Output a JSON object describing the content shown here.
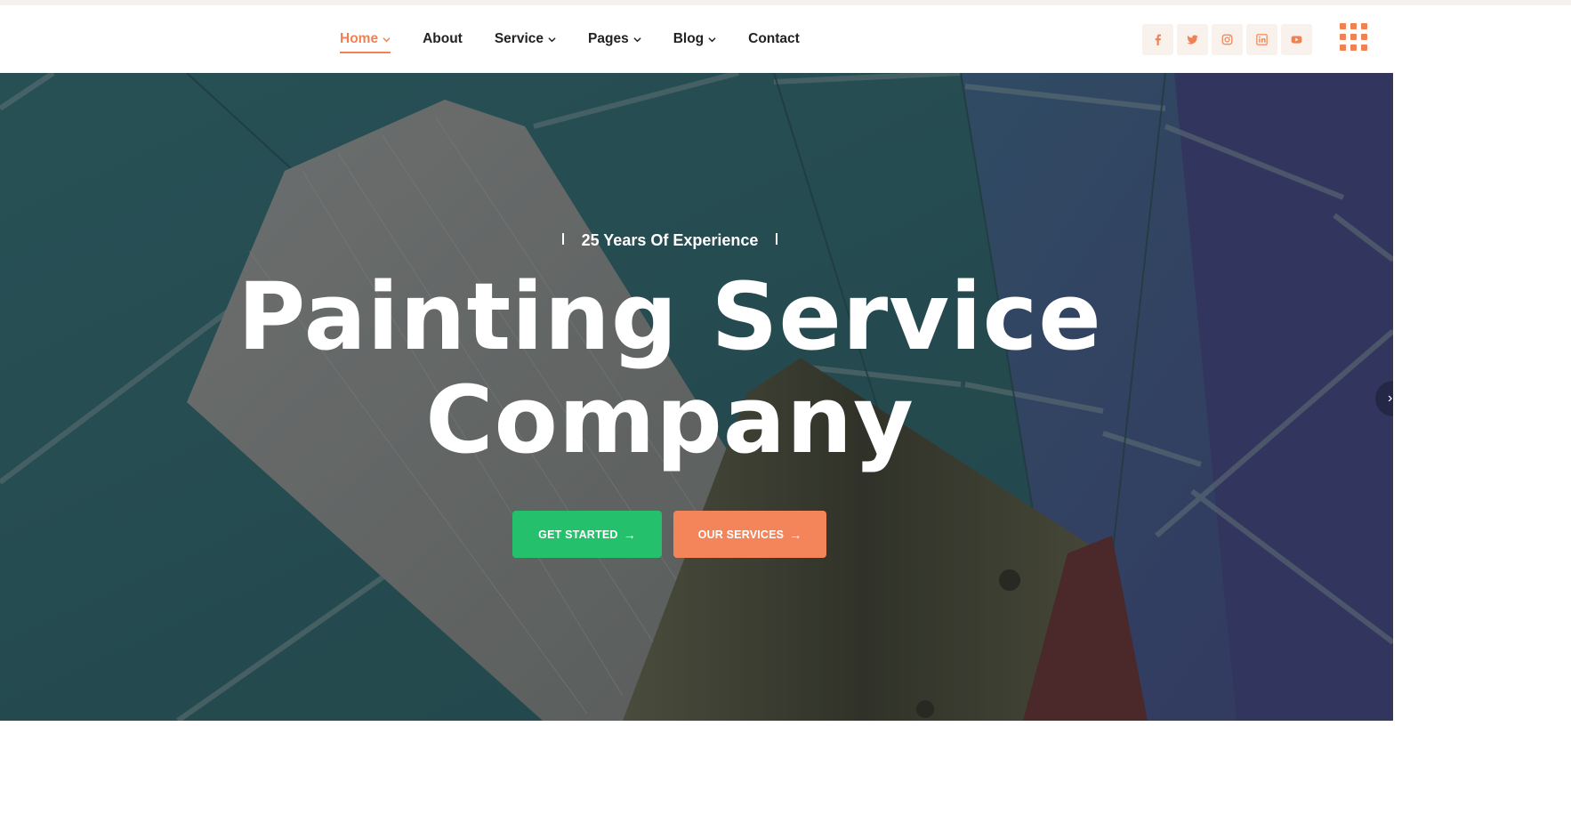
{
  "nav": {
    "items": [
      {
        "label": "Home",
        "active": true,
        "dropdown": true
      },
      {
        "label": "About",
        "active": false,
        "dropdown": false
      },
      {
        "label": "Service",
        "active": false,
        "dropdown": true
      },
      {
        "label": "Pages",
        "active": false,
        "dropdown": true
      },
      {
        "label": "Blog",
        "active": false,
        "dropdown": true
      },
      {
        "label": "Contact",
        "active": false,
        "dropdown": false
      }
    ]
  },
  "social": [
    "facebook-icon",
    "twitter-icon",
    "instagram-icon",
    "linkedin-icon",
    "youtube-icon"
  ],
  "hero": {
    "eyebrow": "25 Years Of Experience",
    "title_line1": "Painting Service",
    "title_line2": "Company",
    "primary_button": "GET STARTED",
    "secondary_button": "OUR SERVICES"
  },
  "colors": {
    "accent": "#f08152",
    "green": "#25c06b",
    "orange_button": "#f4845a"
  }
}
